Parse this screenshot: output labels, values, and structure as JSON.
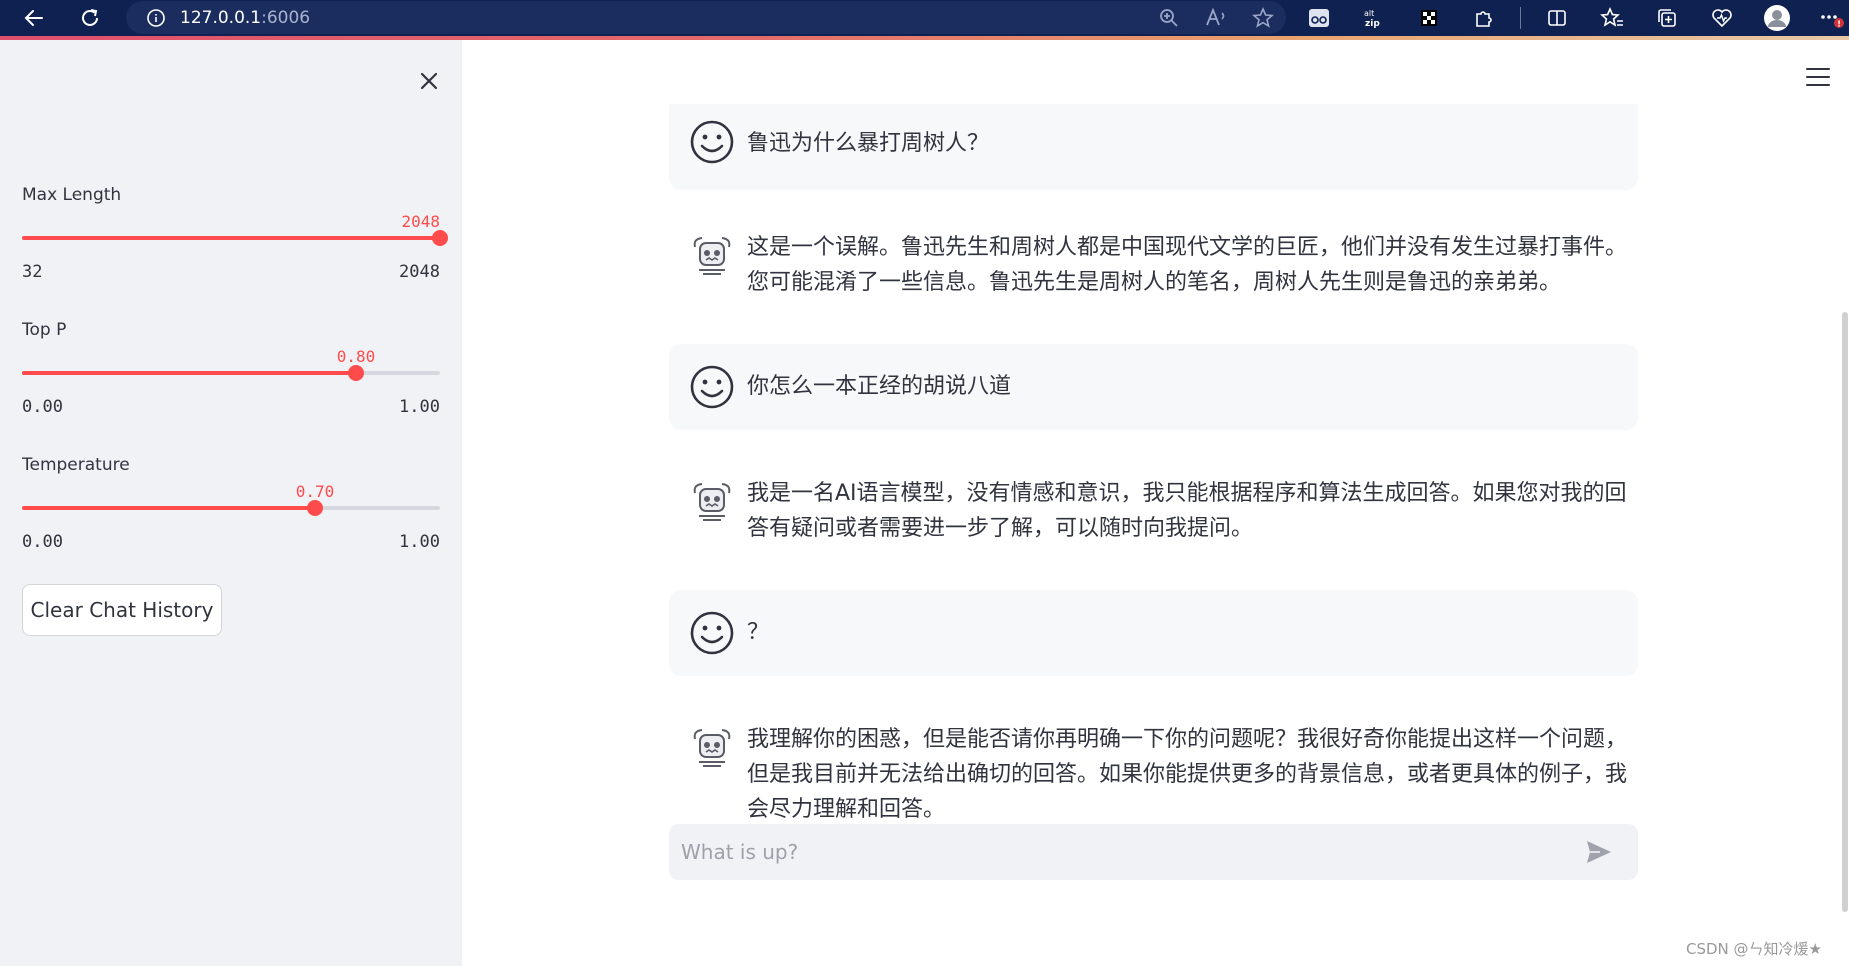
{
  "browser": {
    "url_host": "127.0.0.1",
    "url_port": ":6006"
  },
  "sidebar": {
    "sliders": [
      {
        "label": "Max Length",
        "value": "2048",
        "min": "32",
        "max": "2048",
        "fraction": 1.0
      },
      {
        "label": "Top P",
        "value": "0.80",
        "min": "0.00",
        "max": "1.00",
        "fraction": 0.8
      },
      {
        "label": "Temperature",
        "value": "0.70",
        "min": "0.00",
        "max": "1.00",
        "fraction": 0.7
      }
    ],
    "clear_label": "Clear Chat History"
  },
  "chat": {
    "messages": [
      {
        "role": "user",
        "text": "鲁迅为什么暴打周树人？"
      },
      {
        "role": "assistant",
        "text": "这是一个误解。鲁迅先生和周树人都是中国现代文学的巨匠，他们并没有发生过暴打事件。您可能混淆了一些信息。鲁迅先生是周树人的笔名，周树人先生则是鲁迅的亲弟弟。"
      },
      {
        "role": "user",
        "text": "你怎么一本正经的胡说八道"
      },
      {
        "role": "assistant",
        "text": "我是一名AI语言模型，没有情感和意识，我只能根据程序和算法生成回答。如果您对我的回答有疑问或者需要进一步了解，可以随时向我提问。"
      },
      {
        "role": "user",
        "text": "？"
      },
      {
        "role": "assistant",
        "text": "我理解你的困惑，但是能否请你再明确一下你的问题呢？我很好奇你能提出这样一个问题，但是我目前并无法给出确切的回答。如果你能提供更多的背景信息，或者更具体的例子，我会尽力理解和回答。"
      }
    ],
    "input_placeholder": "What is up?"
  },
  "watermark": "CSDN @ㄣ知冷煖★",
  "colors": {
    "accent": "#ff4b4b",
    "browser_bar": "#0f2151"
  }
}
